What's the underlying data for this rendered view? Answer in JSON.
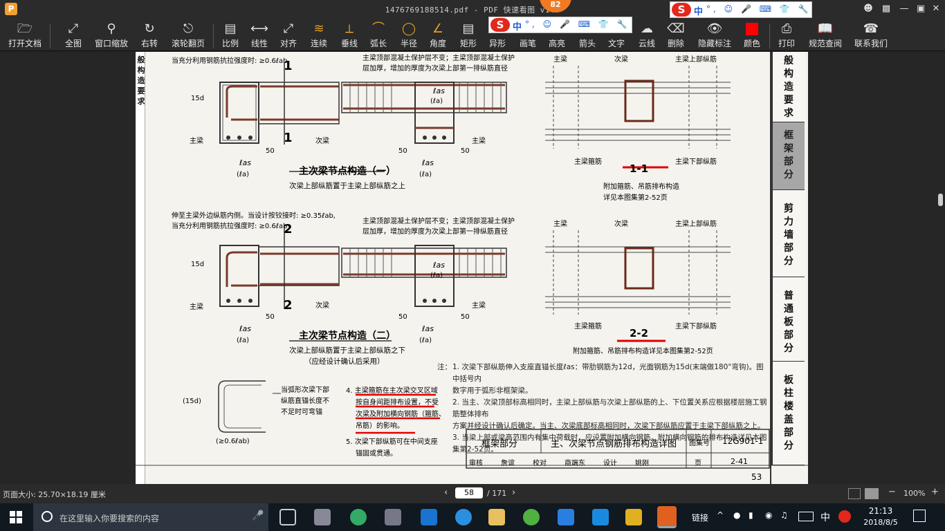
{
  "window": {
    "app_icon": "P",
    "title": "1476769188514.pdf - PDF 快速看图 v1.9",
    "badge": "82",
    "controls": [
      "user-icon",
      "restore-icon",
      "minimize-icon",
      "maximize-icon",
      "close-icon"
    ]
  },
  "ime_bar": {
    "logo": "S",
    "lang": "中",
    "rest": "°, ☺ 🎤 ⌨ 👕 🔧"
  },
  "toolbar": {
    "items": [
      {
        "label": "打开文档",
        "icon": "folder-icon"
      },
      {
        "label": "全图",
        "icon": "fit-all-icon"
      },
      {
        "label": "窗口缩放",
        "icon": "zoom-window-icon"
      },
      {
        "label": "右转",
        "icon": "rotate-right-icon"
      },
      {
        "label": "滚轮翻页",
        "icon": "mouse-wheel-icon"
      },
      {
        "label": "比例",
        "icon": "ruler-icon"
      },
      {
        "label": "线性",
        "icon": "linear-dim-icon"
      },
      {
        "label": "对齐",
        "icon": "aligned-dim-icon"
      },
      {
        "label": "连续",
        "icon": "continuous-icon"
      },
      {
        "label": "垂线",
        "icon": "perpendicular-icon"
      },
      {
        "label": "弧长",
        "icon": "arc-length-icon"
      },
      {
        "label": "半径",
        "icon": "radius-icon"
      },
      {
        "label": "角度",
        "icon": "angle-icon"
      },
      {
        "label": "矩形",
        "icon": "rectangle-icon"
      },
      {
        "label": "异形",
        "icon": "polygon-icon"
      },
      {
        "label": "画笔",
        "icon": "pen-icon"
      },
      {
        "label": "高亮",
        "icon": "highlight-icon"
      },
      {
        "label": "箭头",
        "icon": "arrow-icon"
      },
      {
        "label": "文字",
        "icon": "text-icon"
      },
      {
        "label": "云线",
        "icon": "cloud-icon"
      },
      {
        "label": "删除",
        "icon": "eraser-icon"
      },
      {
        "label": "隐藏标注",
        "icon": "hide-icon"
      },
      {
        "label": "颜色",
        "icon": "color-icon",
        "color": "#ff0000"
      },
      {
        "label": "打印",
        "icon": "print-icon"
      },
      {
        "label": "规范查阅",
        "icon": "book-icon"
      },
      {
        "label": "联系我们",
        "icon": "contact-icon"
      }
    ]
  },
  "page": {
    "left_tab": "般构造要求",
    "side_tabs": [
      {
        "label": "般构造要求",
        "active": false
      },
      {
        "label": "框架部分",
        "active": true
      },
      {
        "label": "剪力墙部分",
        "active": false
      },
      {
        "label": "普通板部分",
        "active": false
      },
      {
        "label": "板柱楼盖部分",
        "active": false
      }
    ],
    "top_note": "当充分利用钢筋抗拉强度时: ≥0.6ℓab",
    "top_note2": "伸至主梁外边纵筋内侧。当设计按铰接时: ≥0.35ℓab,",
    "top_note3": "当充分利用钢筋抗拉强度时: ≥0.6ℓab",
    "label_zhuliang": "主梁",
    "label_ciliang": "次梁",
    "dim_15d": "15d",
    "dim_50": "50",
    "dim_las": "ℓas",
    "dim_la": "(ℓa)",
    "sec_1": "1",
    "sec_2": "2",
    "cover_note": "主梁顶部混凝土保护层不变；主梁顶部混凝土保护层加厚，增加的厚度为次梁上部第一排纵筋直径",
    "cover_note_a": "主梁顶部混凝土保护层不变；主梁顶部混凝土保护",
    "cover_note_b": "层加厚，增加的厚度为次梁上部第一排纵筋直径",
    "title_1": "主次梁节点构造（一）",
    "sub_1": "次梁上部纵筋置于主梁上部纵筋之上",
    "title_2": "主次梁节点构造（二）",
    "sub_2": "次梁上部纵筋置于主梁上部纵筋之下",
    "sub_2b": "（应经设计确认后采用）",
    "sec1_label": "1-1",
    "sec2_label": "2-2",
    "label_zhuliang_top": "主梁上部纵筋",
    "label_zhuliang_bot": "主梁下部纵筋",
    "label_zhuliang_gj": "主梁箍筋",
    "sec1_note_a": "附加箍筋、吊筋排布构造",
    "sec1_note_b": "详见本图集第2-52页",
    "sec2_note": "附加箍筋、吊筋排布构造详见本图集第2-52页",
    "arc_note": [
      "当弧形次梁下部",
      "纵筋直锚长度不",
      "不足时可弯锚"
    ],
    "arc_dim": "(15d)",
    "arc_dim2": "(≥0.6ℓab)",
    "note4": [
      "4. 主梁箍筋在主次梁交叉区域",
      "按自身间距排布设置，不受",
      "次梁及附加横向钢筋（箍筋、",
      "吊筋）的影响。"
    ],
    "note5": [
      "5. 次梁下部纵筋可在中间支座",
      "锚固或贯通。"
    ],
    "notes_head": "注：",
    "notes": [
      "1. 次梁下部纵筋伸入支座直锚长度ℓas：带肋钢筋为12d，光面钢筋为15d(末端做180°弯钩)。图中括号内",
      "   数字用于弧形非框架梁。",
      "2. 当主、次梁顶部标高相同时，主梁上部纵筋与次梁上部纵筋的上、下位置关系应根据楼层施工钢筋整体排布",
      "   方案并经设计确认后确定。当主、次梁底部标高相同时，次梁下部纵筋应置于主梁下部纵筋之上。",
      "3. 当梁上部或梁高范围内有集中荷载时，应设置附加横向钢筋，附加横向钢筋的排布构造详见本图集第2-52页。"
    ],
    "titleblock": {
      "part": "框架部分",
      "name": "主、次梁节点钢筋排布构造详图",
      "atlas_label": "图集号",
      "atlas_no": "12G901-1",
      "row2": [
        "审核",
        "詹谊",
        "校对",
        "商端东",
        "设计",
        "姚刚",
        "页"
      ],
      "page_ref": "2-41"
    },
    "page_number": "53"
  },
  "status": {
    "page_size": "页面大小: 25.70×18.19 厘米",
    "current_page": "58",
    "total_pages": "/ 171",
    "zoom": "100%"
  },
  "taskbar": {
    "search_placeholder": "在这里输入你要搜索的内容",
    "link_label": "链接",
    "ime_lang": "中",
    "time": "21:13",
    "date": "2018/8/5"
  }
}
